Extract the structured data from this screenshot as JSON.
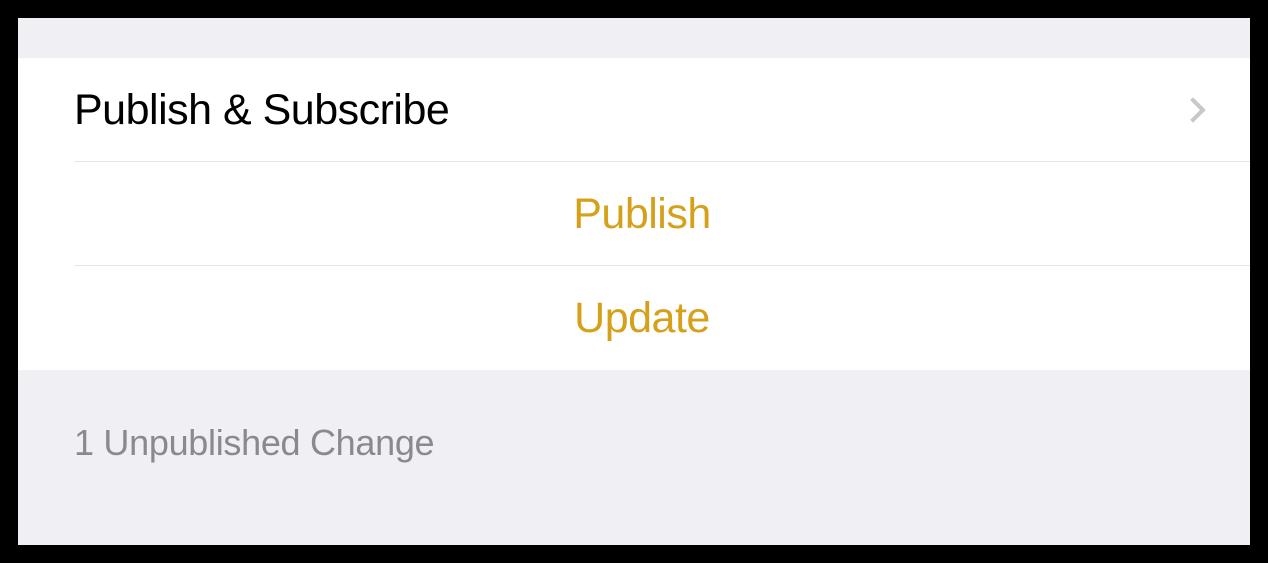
{
  "nav": {
    "title": "Publish & Subscribe"
  },
  "actions": {
    "publish": "Publish",
    "update": "Update"
  },
  "footer": {
    "status": "1 Unpublished Change"
  }
}
